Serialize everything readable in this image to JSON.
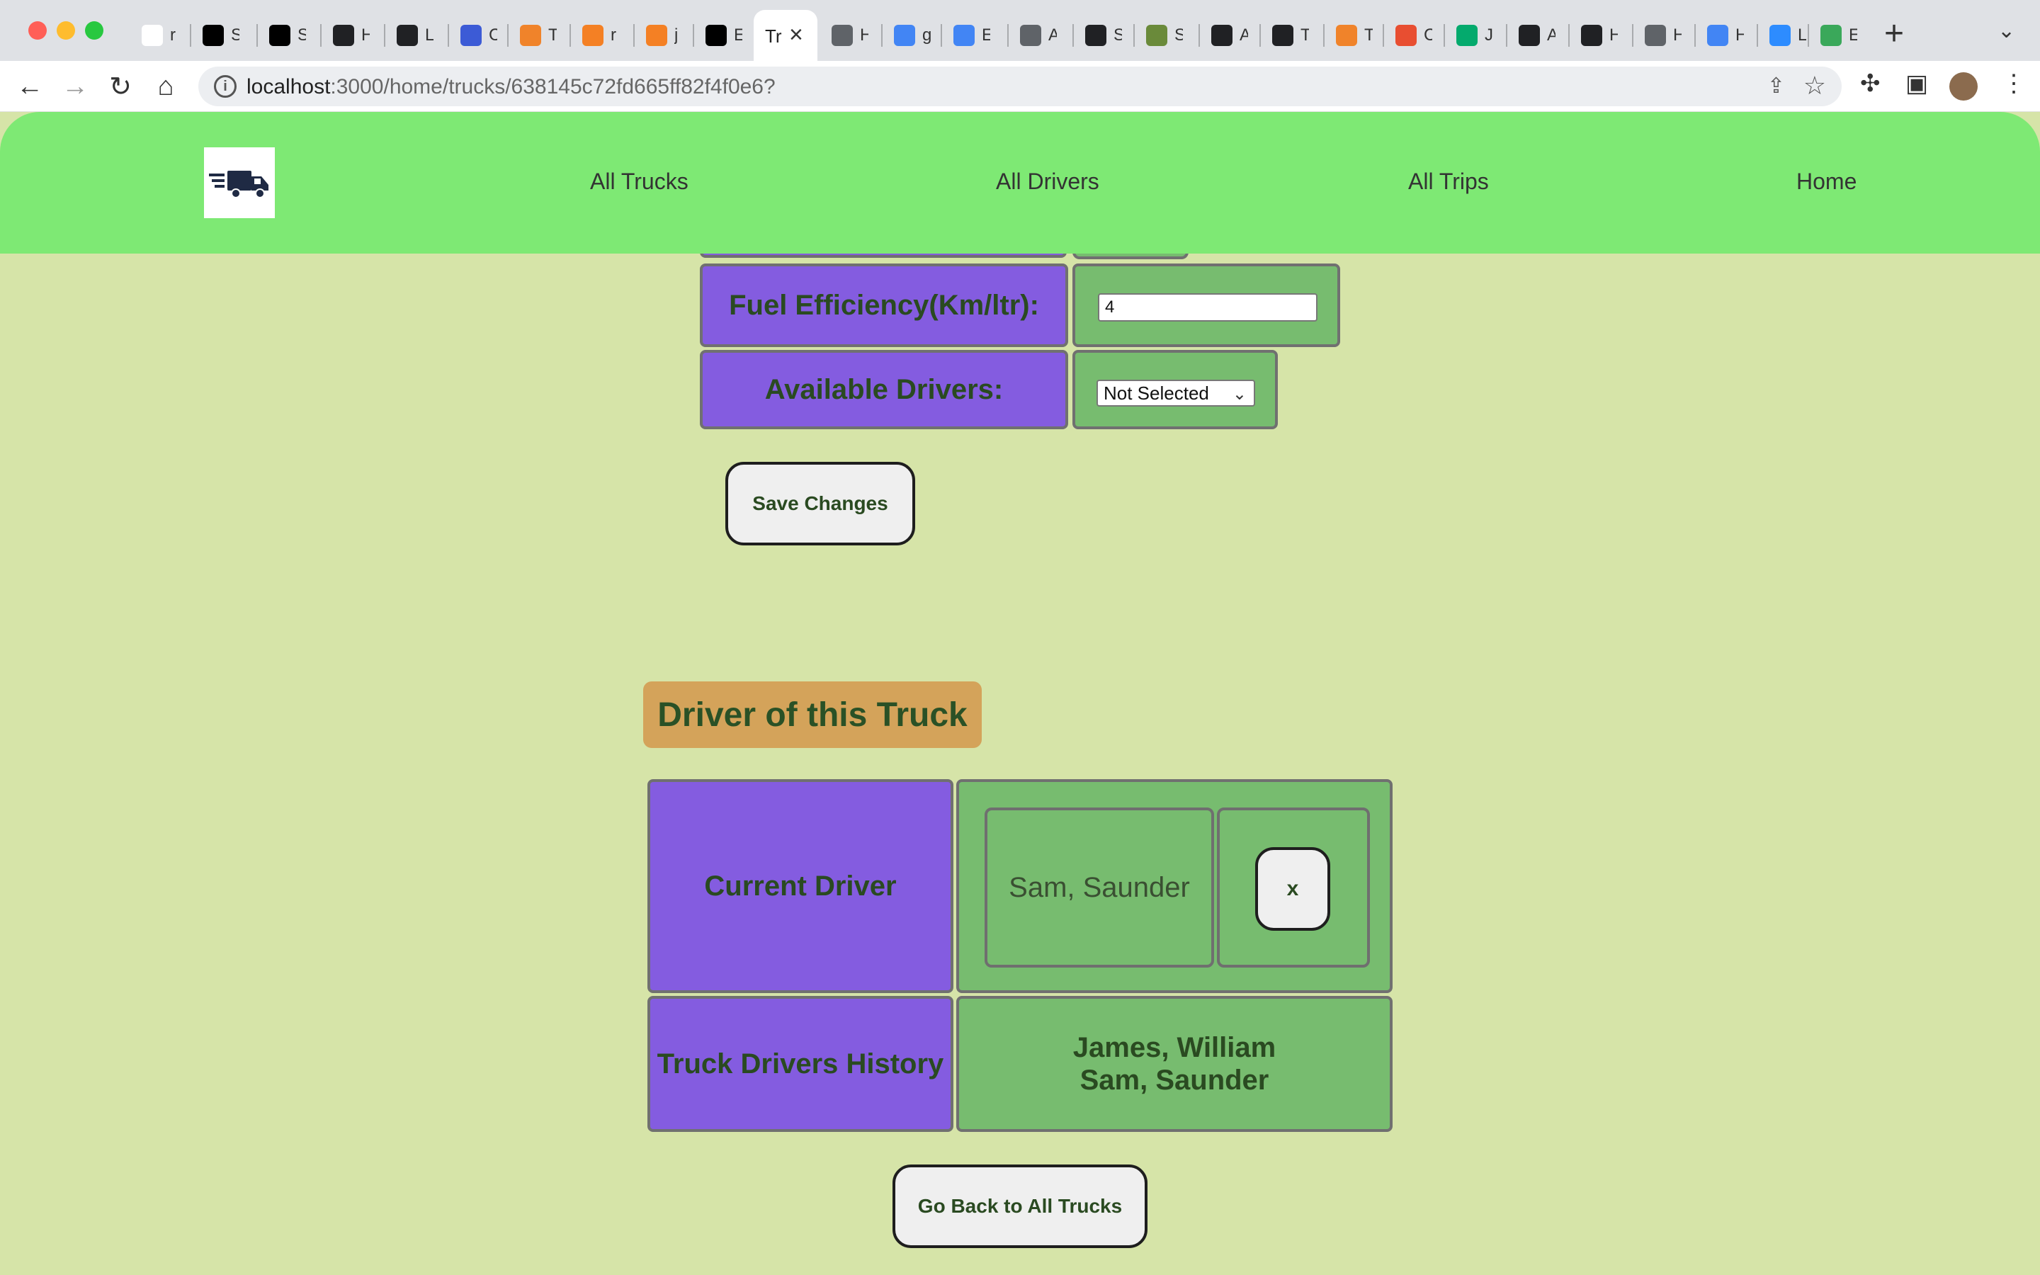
{
  "browser": {
    "tabs": [
      {
        "icon": "github-icon",
        "title": "r",
        "color": "#ffffff"
      },
      {
        "icon": "github-icon",
        "title": "S",
        "color": "#000000"
      },
      {
        "icon": "github-icon",
        "title": "S",
        "color": "#000000"
      },
      {
        "icon": "globe-icon",
        "title": "H",
        "color": "#202124"
      },
      {
        "icon": "mongodb-icon",
        "title": "L",
        "color": "#202124"
      },
      {
        "icon": "api-icon",
        "title": "C",
        "color": "#3c5bd6"
      },
      {
        "icon": "tree-icon",
        "title": "T",
        "color": "#f0832a"
      },
      {
        "icon": "stackoverflow-icon",
        "title": "r",
        "color": "#f48024"
      },
      {
        "icon": "stackoverflow-icon",
        "title": "j",
        "color": "#f48024"
      },
      {
        "icon": "medium-icon",
        "title": "E",
        "color": "#000000"
      },
      {
        "icon": "globe-icon",
        "title": "H",
        "color": "#5f6368"
      },
      {
        "icon": "google-icon",
        "title": "g",
        "color": "#4285f4"
      },
      {
        "icon": "cloud-icon",
        "title": "E",
        "color": "#4285f4"
      },
      {
        "icon": "globe-icon",
        "title": "A",
        "color": "#5f6368"
      },
      {
        "icon": "globe-icon",
        "title": "S",
        "color": "#202124"
      },
      {
        "icon": "sheet-icon",
        "title": "S",
        "color": "#6a8a3a"
      },
      {
        "icon": "globe-icon",
        "title": "A",
        "color": "#202124"
      },
      {
        "icon": "trello-icon",
        "title": "T",
        "color": "#202124"
      },
      {
        "icon": "tree-icon",
        "title": "T",
        "color": "#f0832a"
      },
      {
        "icon": "git-icon",
        "title": "C",
        "color": "#e84e31"
      },
      {
        "icon": "w3-icon",
        "title": "J",
        "color": "#04aa6d"
      },
      {
        "icon": "m-icon",
        "title": "A",
        "color": "#202124"
      },
      {
        "icon": "globe-icon",
        "title": "H",
        "color": "#202124"
      },
      {
        "icon": "globe-icon",
        "title": "H",
        "color": "#5f6368"
      },
      {
        "icon": "google-icon",
        "title": "H",
        "color": "#4285f4"
      },
      {
        "icon": "zoom-icon",
        "title": "L",
        "color": "#2d8cff"
      },
      {
        "icon": "image-icon",
        "title": "E",
        "color": "#3aa85a"
      }
    ],
    "active_tab_title": "Tr",
    "url_host": "localhost",
    "url_rest": ":3000/home/trucks/638145c72fd665ff82f4f0e6?",
    "new_tab_label": "+",
    "tab_menu_label": "⌄"
  },
  "header": {
    "logo_icon": "truck-icon",
    "nav": [
      "All Trucks",
      "All Drivers",
      "All Trips",
      "Home"
    ]
  },
  "form": {
    "fuel_label": "Fuel Efficiency(Km/ltr):",
    "fuel_value": "4",
    "drivers_label": "Available Drivers:",
    "drivers_selected": "Not Selected",
    "save_label": "Save Changes"
  },
  "driver_section": {
    "title": "Driver of this Truck",
    "current_label": "Current Driver",
    "current_driver": "Sam, Saunder",
    "remove_label": "x",
    "history_label": "Truck Drivers History",
    "history": [
      "James, William",
      "Sam, Saunder"
    ]
  },
  "back_label": "Go Back to All Trucks",
  "colors": {
    "page_bg": "#d6e4a8",
    "header_bg": "#7ee974",
    "label_bg": "#845ce0",
    "value_bg": "#77bc6f",
    "title_bg": "#d4a35a",
    "text_green": "#2a4a21"
  }
}
